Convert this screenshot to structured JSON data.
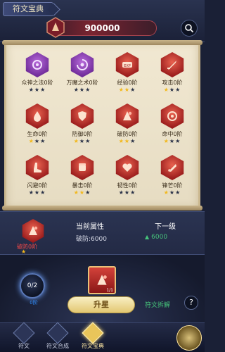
{
  "header": {
    "title": "符文宝典",
    "value": "900000"
  },
  "runes": [
    {
      "name": "众神之法0阶",
      "color": "purple",
      "icon": "spiral-icon",
      "stars": [
        0,
        0,
        0
      ]
    },
    {
      "name": "万魔之术0阶",
      "color": "purple",
      "icon": "vortex-icon",
      "stars": [
        0,
        0,
        0
      ]
    },
    {
      "name": "经验0阶",
      "color": "red",
      "icon": "exp-icon",
      "stars": [
        1,
        1,
        0
      ]
    },
    {
      "name": "攻击0阶",
      "color": "red",
      "icon": "sword-icon",
      "stars": [
        1,
        0,
        0
      ]
    },
    {
      "name": "生命0阶",
      "color": "red",
      "icon": "drop-icon",
      "stars": [
        1,
        0,
        0
      ]
    },
    {
      "name": "防御0阶",
      "color": "red",
      "icon": "shield-icon",
      "stars": [
        1,
        0,
        0
      ]
    },
    {
      "name": "破防0阶",
      "color": "red",
      "icon": "break-icon",
      "stars": [
        1,
        1,
        0
      ]
    },
    {
      "name": "命中0阶",
      "color": "red",
      "icon": "target-icon",
      "stars": [
        1,
        0,
        0
      ]
    },
    {
      "name": "闪避0阶",
      "color": "red",
      "icon": "boot-icon",
      "stars": [
        0,
        0,
        0
      ]
    },
    {
      "name": "暴击0阶",
      "color": "red",
      "icon": "fist-icon",
      "stars": [
        1,
        1,
        0
      ]
    },
    {
      "name": "韧性0阶",
      "color": "red",
      "icon": "heart-icon",
      "stars": [
        0,
        0,
        0
      ]
    },
    {
      "name": "锋芒0阶",
      "color": "red",
      "icon": "blade-icon",
      "stars": [
        1,
        0,
        0
      ]
    }
  ],
  "detail": {
    "selected_label": "破防0阶",
    "current_header": "当前属性",
    "current_value": "破防:6000",
    "next_header": "下一级",
    "next_value": "6000"
  },
  "action": {
    "progress": "0/2",
    "progress_caption": "0阶",
    "card_count": "1/1",
    "upgrade_label": "升星",
    "dismantle_label": "符文拆解",
    "help_label": "?"
  },
  "nav": [
    {
      "label": "符文",
      "active": false
    },
    {
      "label": "符文合成",
      "active": false
    },
    {
      "label": "符文宝典",
      "active": true
    }
  ],
  "colors": {
    "star_on": "#f2b81c",
    "star_off": "#283046",
    "green": "#46c37b",
    "red_text": "#f24848"
  }
}
